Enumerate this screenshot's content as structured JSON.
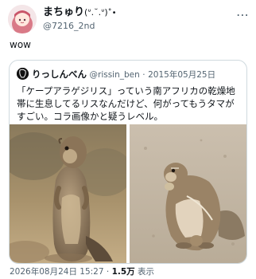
{
  "author": {
    "display_name": "まちゅり",
    "name_suffix": "(ᐡ.˘.ᐡ)",
    "name_emoji": "˚•",
    "handle": "@7216_2nd"
  },
  "post": {
    "text": "wow",
    "timestamp": "2026年08月24日 15:27",
    "separator": "·",
    "views_count": "1.5万",
    "views_label": "表示"
  },
  "quoted": {
    "display_name": "りっしんべん",
    "handle": "@rissin_ben",
    "separator": "·",
    "date": "2015年05月25日",
    "text": "「ケープアラゲジリス」っていう南アフリカの乾燥地帯に生息してるリスなんだけど、何がってもうタマがすごい。コラ画像かと疑うレベル。"
  },
  "icons": {
    "more": "more-options-icon",
    "avatar": "user-avatar",
    "quoted_avatar": "quoted-user-avatar"
  }
}
